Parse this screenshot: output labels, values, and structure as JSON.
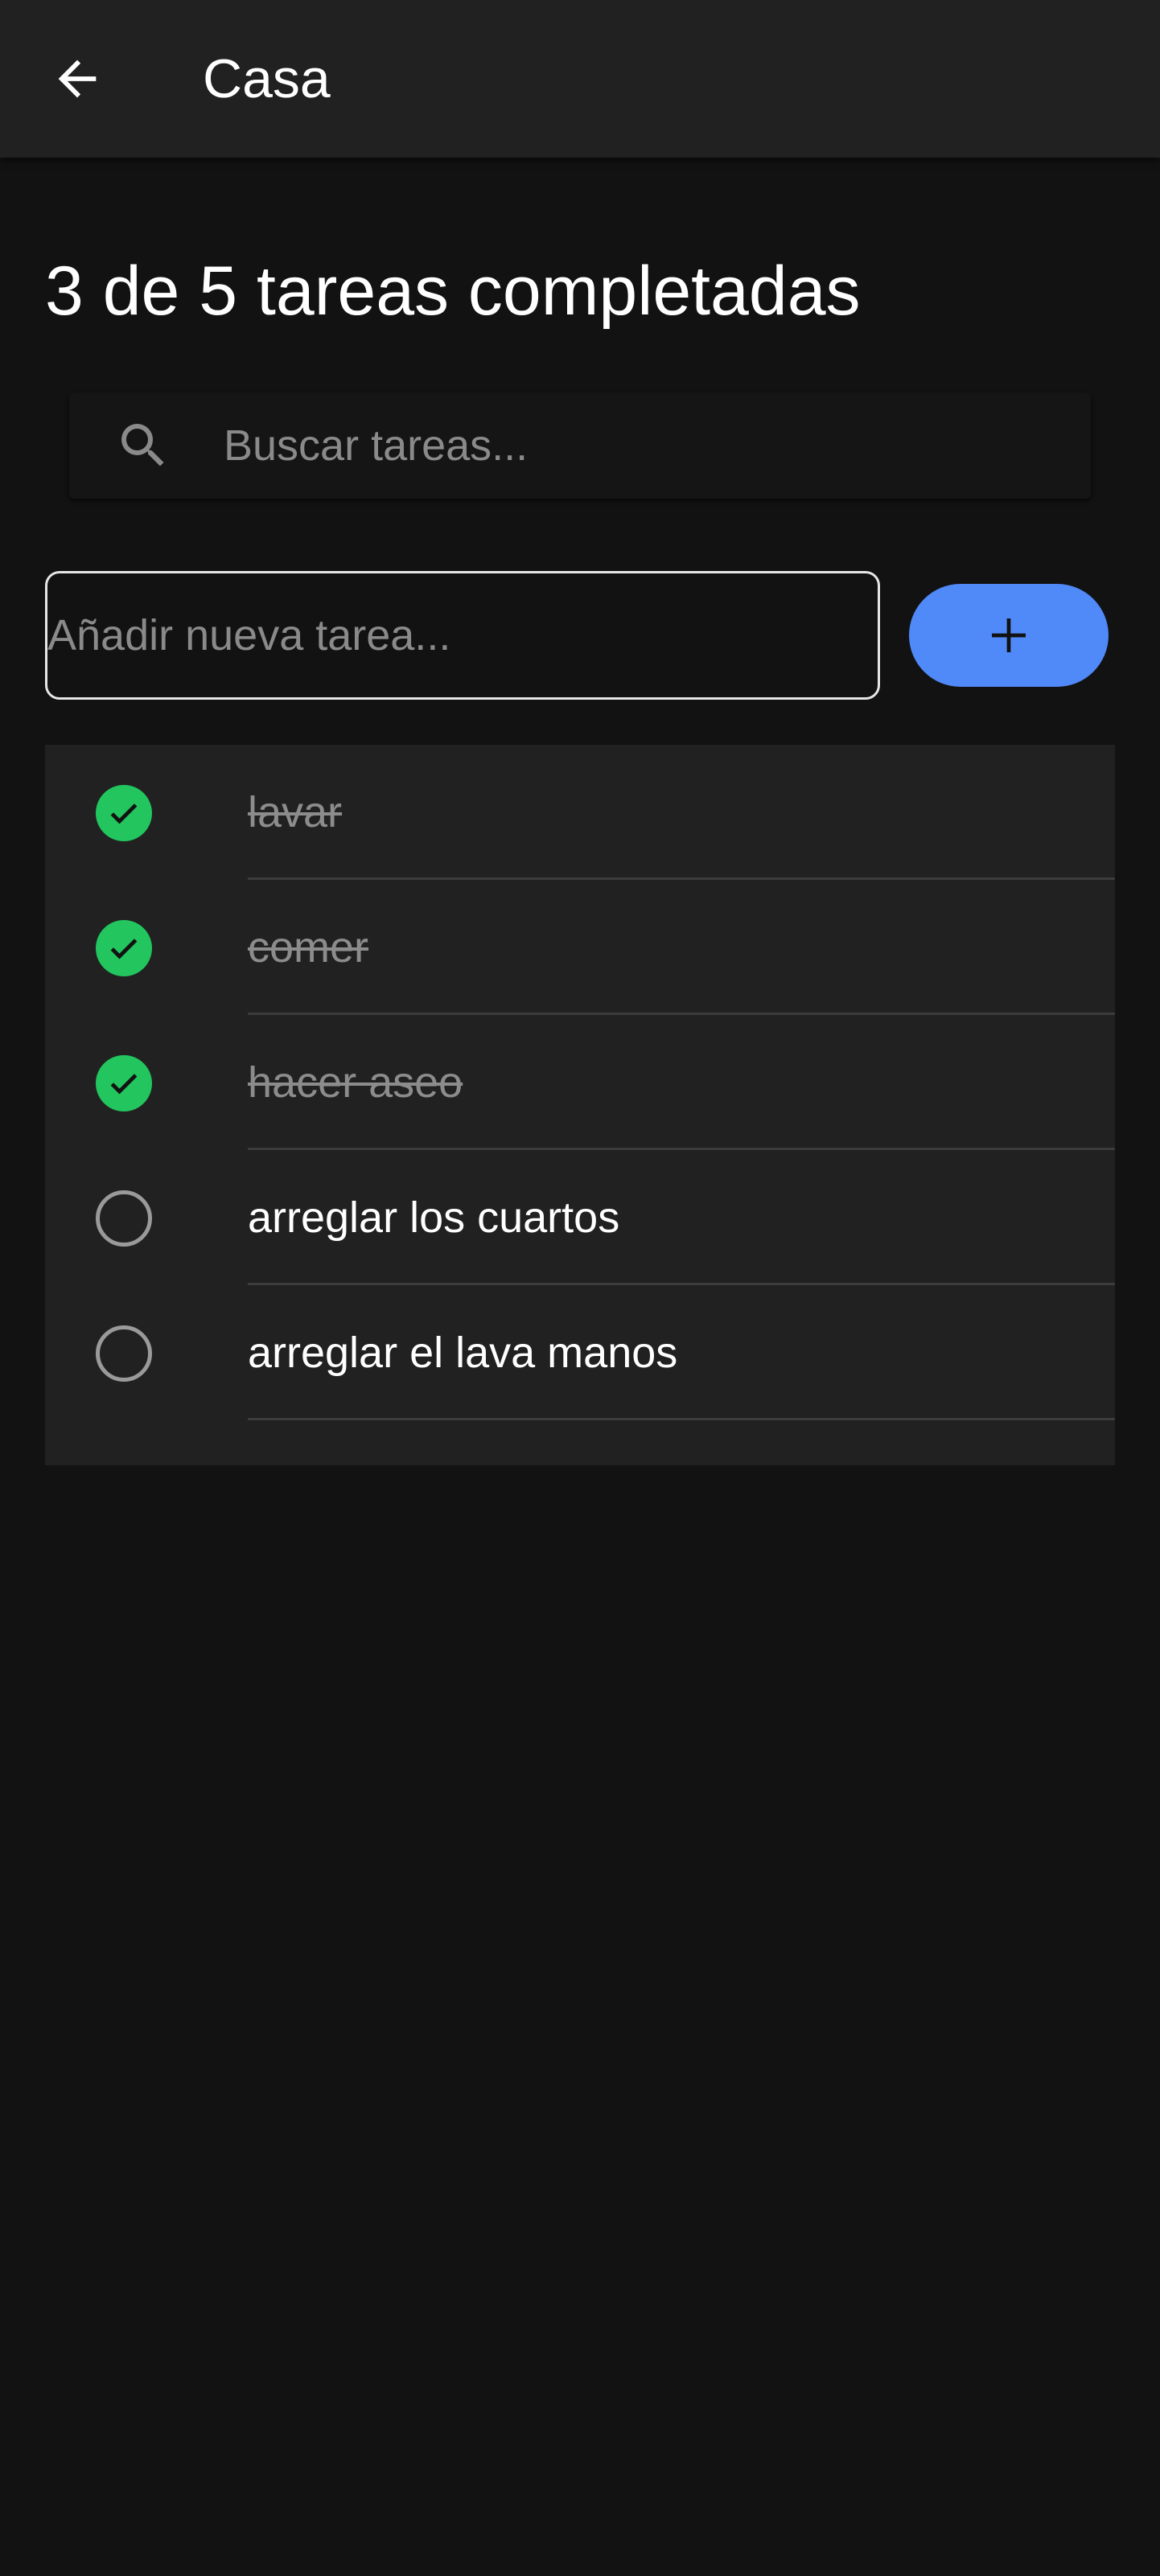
{
  "app_bar": {
    "back_icon": "arrow-left-icon",
    "title": "Casa"
  },
  "summary": {
    "text": "3 de 5 tareas completadas",
    "completed": 3,
    "total": 5
  },
  "search": {
    "icon": "search-icon",
    "placeholder": "Buscar tareas...",
    "value": ""
  },
  "new_task": {
    "placeholder": "Añadir nueva tarea...",
    "value": "",
    "add_icon": "plus-icon"
  },
  "tasks": [
    {
      "label": "lavar",
      "done": true
    },
    {
      "label": "comer",
      "done": true
    },
    {
      "label": "hacer aseo",
      "done": true
    },
    {
      "label": "arreglar los cuartos",
      "done": false
    },
    {
      "label": "arreglar el lava manos",
      "done": false
    }
  ],
  "colors": {
    "background": "#121212",
    "surface": "#212121",
    "accent": "#5089f8",
    "done_check": "#22c55e",
    "done_text": "#8c8c8c"
  }
}
